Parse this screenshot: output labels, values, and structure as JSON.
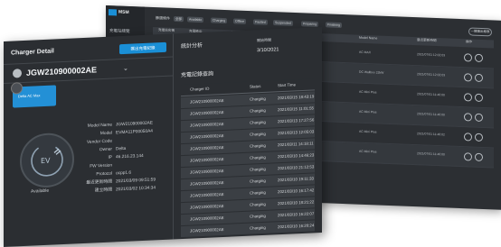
{
  "back_window": {
    "brand": "MSM",
    "sidebar": [
      "充電站總覽",
      "用戶管理",
      "設定",
      "報表"
    ],
    "filters": [
      "篩選條件",
      "全部",
      "Available",
      "Charging",
      "Offline",
      "Faulted",
      "Suspended",
      "Preparing",
      "Finishing"
    ],
    "export_label": "一鍵匯出報表",
    "columns": [
      "充電站名稱",
      "充電樁ID",
      "充電樁名稱",
      "Vendor Code",
      "Model",
      "Model Name",
      "最近更新時間",
      "操作"
    ],
    "rows": [
      {
        "model": "AC MAX",
        "time": "2021/07/01 12:02:03"
      },
      {
        "model": "DC Wallbox 22kW",
        "time": "2021/07/01 12:02:03"
      },
      {
        "model": "AC Mini Plus",
        "time": "2021/07/01 11:46:00"
      },
      {
        "model": "AC Mini Plus",
        "time": "2021/07/01 11:46:00"
      },
      {
        "model": "AC Mini Plus",
        "time": "2021/07/01 11:48:02"
      },
      {
        "model": "AC Mini Plus",
        "time": "2021/07/01 11:46:00"
      }
    ]
  },
  "front_window": {
    "title": "Charger Detail",
    "action_button": "匯出充電紀錄",
    "charger_name": "JGW210900002AE",
    "thumb_label": "Delta AC Max",
    "status": "Available",
    "details": [
      {
        "label": "Model Name",
        "value": "JGW210900002AE"
      },
      {
        "label": "Model",
        "value": "EVMA11P00050A4"
      },
      {
        "label": "Vendor Code",
        "value": ""
      },
      {
        "label": "Owner",
        "value": "Delta"
      },
      {
        "label": "IP",
        "value": "46.216.23.144"
      },
      {
        "label": "FW Version",
        "value": ""
      },
      {
        "label": "Protocol",
        "value": "ocpp1.6"
      },
      {
        "label": "最近更新時間",
        "value": "2021/03/09 09:51:59"
      },
      {
        "label": "建立時間",
        "value": "2021/03/02 10:34:34"
      }
    ],
    "stats_title": "統計分析",
    "stats_sub": "開始時間",
    "stats_date": "3/10/2021",
    "history_title": "充電記錄查詢",
    "history_columns": [
      "Charger ID",
      "Status",
      "Start Time"
    ],
    "history": [
      {
        "id": "JGW210900002AE",
        "status": "Charging",
        "start": "2021/03/15 18:43:19"
      },
      {
        "id": "JGW210900002AE",
        "status": "Charging",
        "start": "2021/03/15 11:01:55"
      },
      {
        "id": "JGW210900002AE",
        "status": "Charging",
        "start": "2021/03/13 17:27:56"
      },
      {
        "id": "JGW210900002AE",
        "status": "Charging",
        "start": "2021/03/13 12:05:03"
      },
      {
        "id": "JGW210900002AE",
        "status": "Charging",
        "start": "2021/03/11 14:18:11"
      },
      {
        "id": "JGW210900002AE",
        "status": "Charging",
        "start": "2021/03/10 14:46:23"
      },
      {
        "id": "JGW210900002AE",
        "status": "Charging",
        "start": "2021/03/10 21:12:53"
      },
      {
        "id": "JGW210900002AE",
        "status": "Charging",
        "start": "2021/03/10 19:11:33"
      },
      {
        "id": "JGW210900002AE",
        "status": "Charging",
        "start": "2021/03/10 16:17:42"
      },
      {
        "id": "JGW210900002AE",
        "status": "Charging",
        "start": "2021/03/10 18:21:22"
      },
      {
        "id": "JGW210900002AE",
        "status": "Charging",
        "start": "2021/03/10 16:22:07"
      },
      {
        "id": "JGW210900002AE",
        "status": "Charging",
        "start": "2021/03/10 16:20:24"
      }
    ]
  },
  "colors": {
    "accent_blue": "#1a8fd6",
    "window_bg": "#2b2e32",
    "row_bg": "#3b3f44"
  }
}
